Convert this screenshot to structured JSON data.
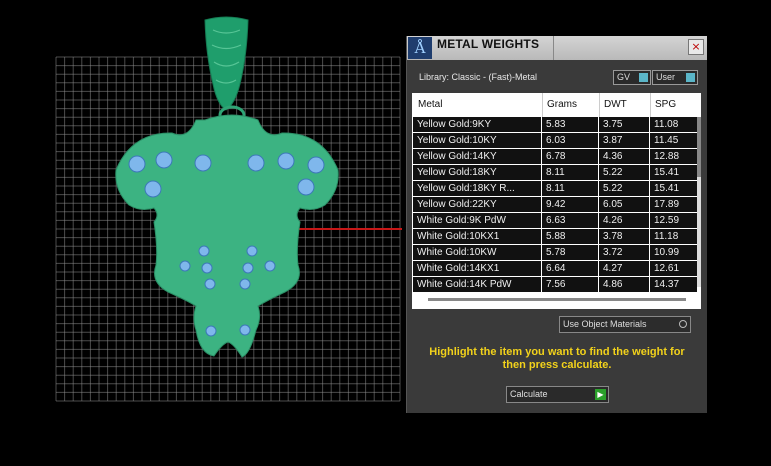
{
  "panel": {
    "title": "METAL WEIGHTS",
    "close_icon": "×",
    "logo_glyph": "Å",
    "library_label": "Library: Classic - (Fast)-Metal",
    "gv_label": "GV",
    "user_label": "User",
    "columns": [
      "Metal",
      "Grams",
      "DWT",
      "SPG"
    ],
    "rows": [
      [
        "Yellow Gold:9KY",
        "5.83",
        "3.75",
        "11.08"
      ],
      [
        "Yellow Gold:10KY",
        "6.03",
        "3.87",
        "11.45"
      ],
      [
        "Yellow Gold:14KY",
        "6.78",
        "4.36",
        "12.88"
      ],
      [
        "Yellow Gold:18KY",
        "8.11",
        "5.22",
        "15.41"
      ],
      [
        "Yellow Gold:18KY R...",
        "8.11",
        "5.22",
        "15.41"
      ],
      [
        "Yellow Gold:22KY",
        "9.42",
        "6.05",
        "17.89"
      ],
      [
        "White Gold:9K PdW",
        "6.63",
        "4.26",
        "12.59"
      ],
      [
        "White Gold:10KX1",
        "5.88",
        "3.78",
        "11.18"
      ],
      [
        "White Gold:10KW",
        "5.78",
        "3.72",
        "10.99"
      ],
      [
        "White Gold:14KX1",
        "6.64",
        "4.27",
        "12.61"
      ],
      [
        "White Gold:14K PdW",
        "7.56",
        "4.86",
        "14.37"
      ]
    ],
    "material_select": "Use Object Materials",
    "instructions": "Highlight the item you want to find the weight for then press calculate.",
    "calculate_label": "Calculate",
    "calculate_icon": "▶"
  },
  "colors": {
    "background": "#000000",
    "grid": "#8a8a8a",
    "pendant": "#3cb382",
    "bail": "#1f9e6c",
    "stone": "#7fb7ec",
    "axis": "#c81818",
    "instructions": "#f2d21b",
    "calculate_arrow": "#2ba02b"
  },
  "icons": [
    "app-logo-icon",
    "close-icon",
    "toggle-switch-icon",
    "radio-knob-icon",
    "play-arrow-icon"
  ]
}
